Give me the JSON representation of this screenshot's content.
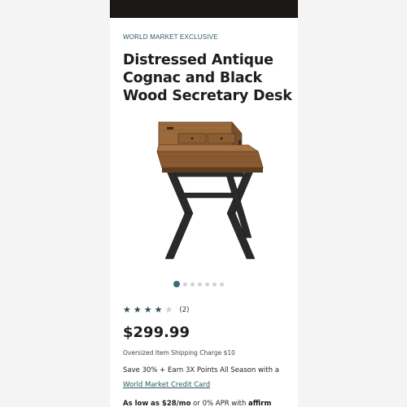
{
  "header": {
    "eyebrow": "WORLD MARKET EXCLUSIVE"
  },
  "product": {
    "title": "Distressed Antique Cognac and Black Wood Secretary Desk",
    "image_icon": "secretary-desk-image",
    "carousel": {
      "total": 7,
      "active": 1
    },
    "rating": {
      "value": 4,
      "max": 5,
      "count_text": "(2)"
    },
    "price": "$299.99",
    "shipping": "Oversized Item Shipping Charge $10",
    "promo": "Save 30% + Earn 3X Points All Season with a",
    "card_link": "World Market Credit Card",
    "financing": {
      "lead": "As low as $28/mo",
      "mid": " or 0% APR with ",
      "brand": "affirm"
    }
  },
  "colors": {
    "accent": "#2d5a63",
    "topbar": "#1b1714"
  }
}
